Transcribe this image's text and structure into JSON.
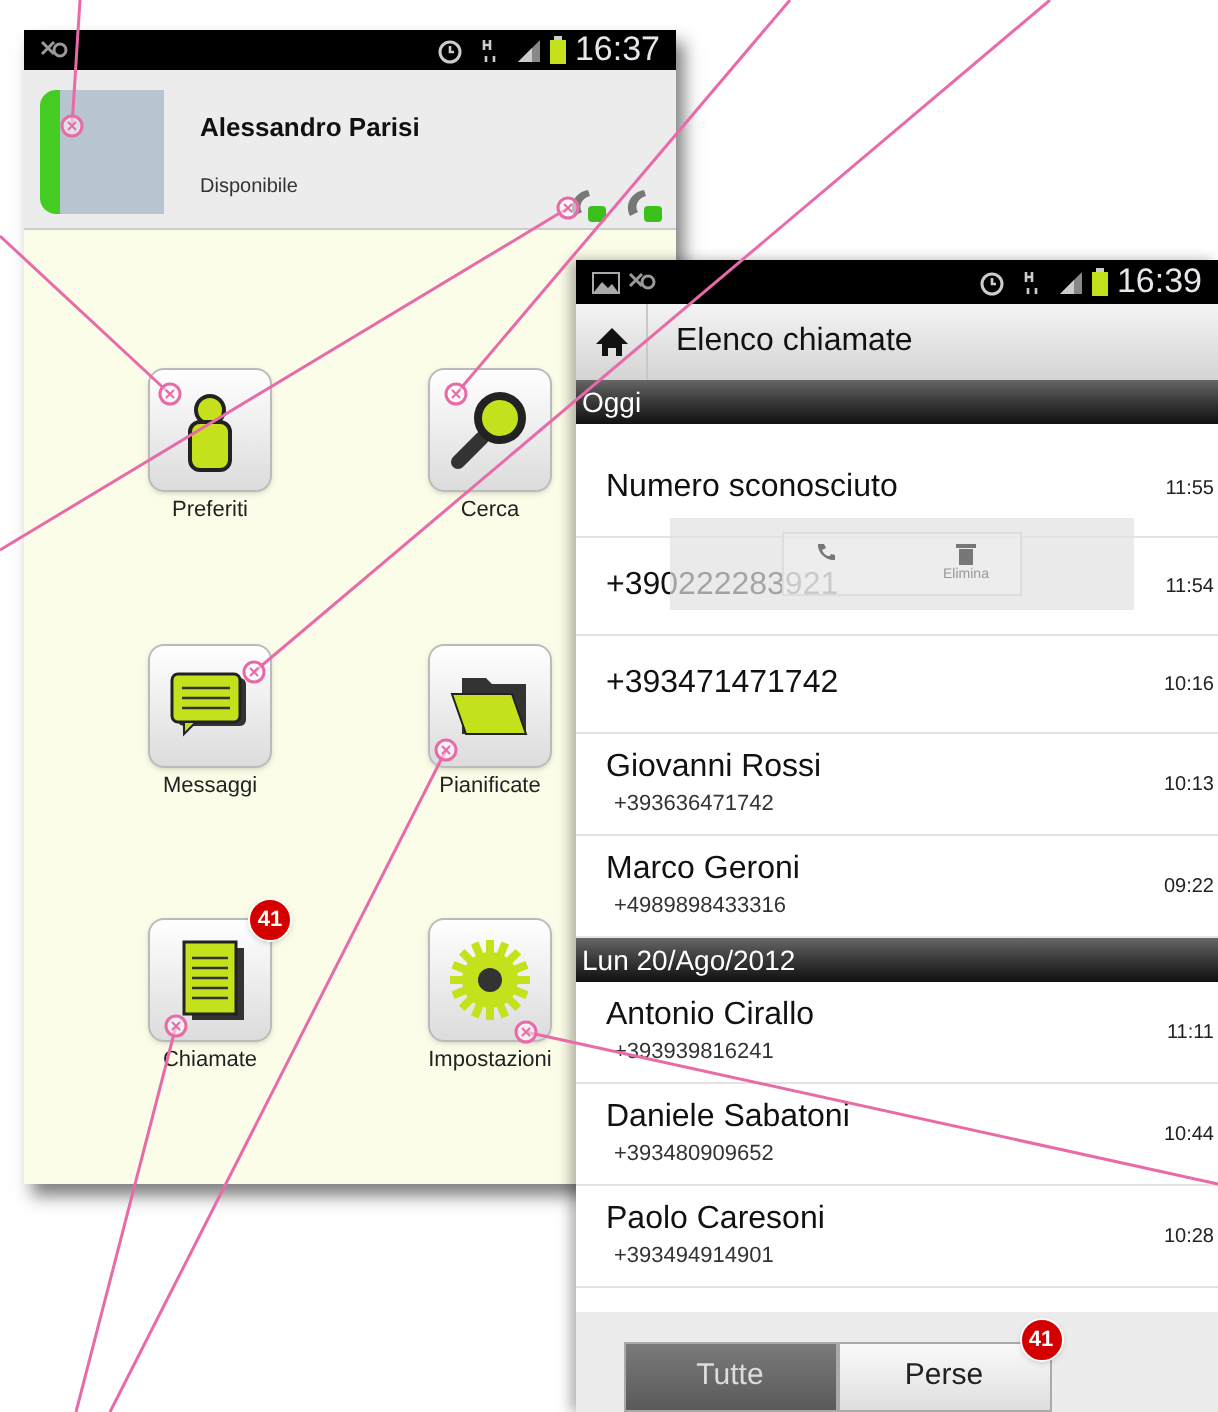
{
  "home_screen": {
    "status_bar": {
      "time": "16:37"
    },
    "profile": {
      "name": "Alessandro Parisi",
      "status": "Disponibile",
      "online": true
    },
    "menu": [
      {
        "label": "Preferiti",
        "kind": "person"
      },
      {
        "label": "Cerca",
        "kind": "search"
      },
      {
        "label": "Messaggi",
        "kind": "message"
      },
      {
        "label": "Pianificate",
        "kind": "folder"
      },
      {
        "label": "Chiamate",
        "kind": "log",
        "badge": "41"
      },
      {
        "label": "Impostazioni",
        "kind": "settings"
      }
    ]
  },
  "call_log": {
    "status_bar": {
      "time": "16:39"
    },
    "title": "Elenco chiamate",
    "sections": [
      {
        "title": "Oggi",
        "calls": [
          {
            "name": "Numero sconosciuto",
            "time": "11:55"
          },
          {
            "name": "+390222283921",
            "time": "11:54",
            "popup": {
              "delete_label": "Elimina"
            }
          },
          {
            "name": "+393471471742",
            "time": "10:16"
          },
          {
            "name": "Giovanni Rossi",
            "number": "+393636471742",
            "time": "10:13"
          },
          {
            "name": "Marco Geroni",
            "number": "+4989898433316",
            "time": "09:22"
          }
        ]
      },
      {
        "title": "Lun 20/Ago/2012",
        "calls": [
          {
            "name": "Antonio Cirallo",
            "number": "+393939816241",
            "time": "11:11"
          },
          {
            "name": "Daniele Sabatoni",
            "number": "+393480909652",
            "time": "10:44"
          },
          {
            "name": "Paolo Caresoni",
            "number": "+393494914901",
            "time": "10:28"
          }
        ]
      }
    ]
  },
  "tabs": [
    {
      "label": "Tutte",
      "selected": true
    },
    {
      "label": "Perse",
      "selected": false,
      "badge": "41"
    }
  ]
}
